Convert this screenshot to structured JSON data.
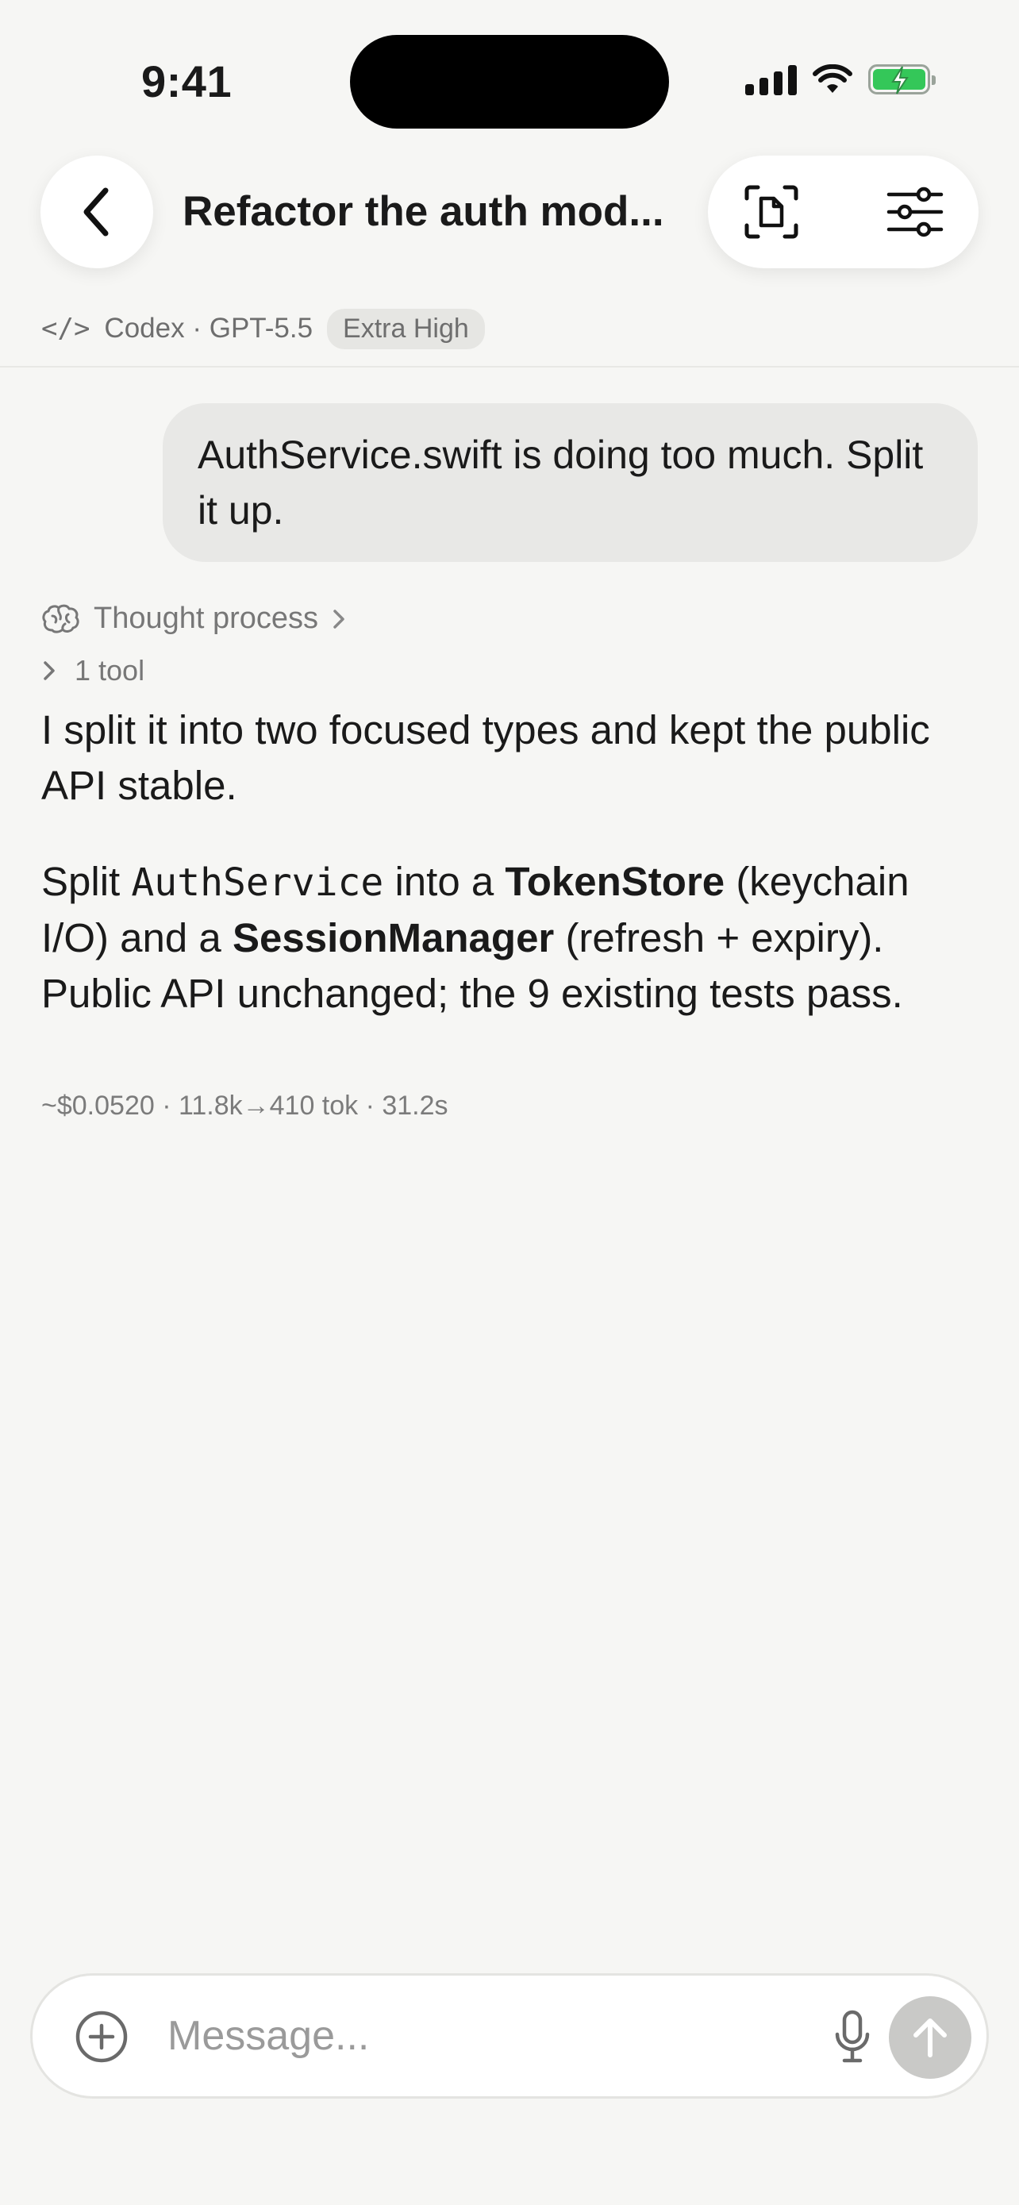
{
  "status_bar": {
    "time": "9:41"
  },
  "header": {
    "title": "Refactor the auth mod..."
  },
  "meta": {
    "agent": "Codex",
    "separator": "·",
    "model": "GPT-5.5",
    "effort_badge": "Extra High"
  },
  "conversation": {
    "user_message": "AuthService.swift is doing too much. Split it up.",
    "thought_label": "Thought process",
    "tools_label": "1 tool",
    "reply_summary": "I split it into two focused types and kept the public API stable.",
    "reply_detail": {
      "p1": "Split ",
      "code": "AuthService",
      "p2": " into a ",
      "bold1": "TokenStore",
      "p3": " (keychain I/O) and a ",
      "bold2": "SessionManager",
      "p4": " (refresh + expiry). Public API unchanged; the 9 existing tests pass."
    },
    "stats": "~$0.0520 · 11.8k→410 tok · 31.2s"
  },
  "composer": {
    "placeholder": "Message..."
  },
  "icons": {
    "back": "chevron-left-icon",
    "doc": "document-scan-icon",
    "settings": "sliders-icon",
    "code": "code-brackets-icon",
    "brain": "brain-icon",
    "plus": "plus-circle-icon",
    "mic": "microphone-icon",
    "send": "arrow-up-icon"
  },
  "colors": {
    "background": "#f6f6f4",
    "bubble": "#e8e8e6",
    "battery": "#34c759",
    "send_disabled": "#c9c9c7"
  }
}
